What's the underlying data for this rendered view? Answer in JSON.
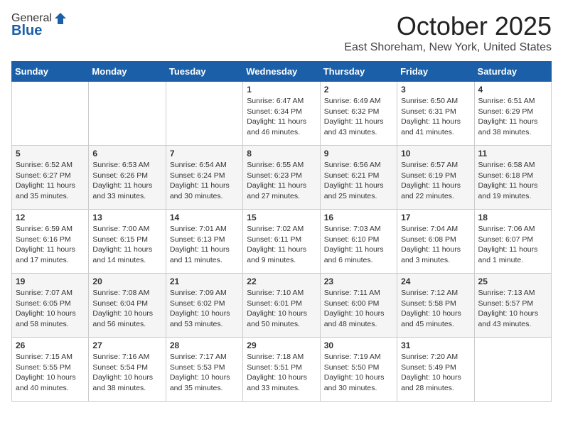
{
  "logo": {
    "general": "General",
    "blue": "Blue"
  },
  "header": {
    "month": "October 2025",
    "location": "East Shoreham, New York, United States"
  },
  "days_of_week": [
    "Sunday",
    "Monday",
    "Tuesday",
    "Wednesday",
    "Thursday",
    "Friday",
    "Saturday"
  ],
  "weeks": [
    [
      {
        "day": "",
        "sunrise": "",
        "sunset": "",
        "daylight": ""
      },
      {
        "day": "",
        "sunrise": "",
        "sunset": "",
        "daylight": ""
      },
      {
        "day": "",
        "sunrise": "",
        "sunset": "",
        "daylight": ""
      },
      {
        "day": "1",
        "sunrise": "Sunrise: 6:47 AM",
        "sunset": "Sunset: 6:34 PM",
        "daylight": "Daylight: 11 hours and 46 minutes."
      },
      {
        "day": "2",
        "sunrise": "Sunrise: 6:49 AM",
        "sunset": "Sunset: 6:32 PM",
        "daylight": "Daylight: 11 hours and 43 minutes."
      },
      {
        "day": "3",
        "sunrise": "Sunrise: 6:50 AM",
        "sunset": "Sunset: 6:31 PM",
        "daylight": "Daylight: 11 hours and 41 minutes."
      },
      {
        "day": "4",
        "sunrise": "Sunrise: 6:51 AM",
        "sunset": "Sunset: 6:29 PM",
        "daylight": "Daylight: 11 hours and 38 minutes."
      }
    ],
    [
      {
        "day": "5",
        "sunrise": "Sunrise: 6:52 AM",
        "sunset": "Sunset: 6:27 PM",
        "daylight": "Daylight: 11 hours and 35 minutes."
      },
      {
        "day": "6",
        "sunrise": "Sunrise: 6:53 AM",
        "sunset": "Sunset: 6:26 PM",
        "daylight": "Daylight: 11 hours and 33 minutes."
      },
      {
        "day": "7",
        "sunrise": "Sunrise: 6:54 AM",
        "sunset": "Sunset: 6:24 PM",
        "daylight": "Daylight: 11 hours and 30 minutes."
      },
      {
        "day": "8",
        "sunrise": "Sunrise: 6:55 AM",
        "sunset": "Sunset: 6:23 PM",
        "daylight": "Daylight: 11 hours and 27 minutes."
      },
      {
        "day": "9",
        "sunrise": "Sunrise: 6:56 AM",
        "sunset": "Sunset: 6:21 PM",
        "daylight": "Daylight: 11 hours and 25 minutes."
      },
      {
        "day": "10",
        "sunrise": "Sunrise: 6:57 AM",
        "sunset": "Sunset: 6:19 PM",
        "daylight": "Daylight: 11 hours and 22 minutes."
      },
      {
        "day": "11",
        "sunrise": "Sunrise: 6:58 AM",
        "sunset": "Sunset: 6:18 PM",
        "daylight": "Daylight: 11 hours and 19 minutes."
      }
    ],
    [
      {
        "day": "12",
        "sunrise": "Sunrise: 6:59 AM",
        "sunset": "Sunset: 6:16 PM",
        "daylight": "Daylight: 11 hours and 17 minutes."
      },
      {
        "day": "13",
        "sunrise": "Sunrise: 7:00 AM",
        "sunset": "Sunset: 6:15 PM",
        "daylight": "Daylight: 11 hours and 14 minutes."
      },
      {
        "day": "14",
        "sunrise": "Sunrise: 7:01 AM",
        "sunset": "Sunset: 6:13 PM",
        "daylight": "Daylight: 11 hours and 11 minutes."
      },
      {
        "day": "15",
        "sunrise": "Sunrise: 7:02 AM",
        "sunset": "Sunset: 6:11 PM",
        "daylight": "Daylight: 11 hours and 9 minutes."
      },
      {
        "day": "16",
        "sunrise": "Sunrise: 7:03 AM",
        "sunset": "Sunset: 6:10 PM",
        "daylight": "Daylight: 11 hours and 6 minutes."
      },
      {
        "day": "17",
        "sunrise": "Sunrise: 7:04 AM",
        "sunset": "Sunset: 6:08 PM",
        "daylight": "Daylight: 11 hours and 3 minutes."
      },
      {
        "day": "18",
        "sunrise": "Sunrise: 7:06 AM",
        "sunset": "Sunset: 6:07 PM",
        "daylight": "Daylight: 11 hours and 1 minute."
      }
    ],
    [
      {
        "day": "19",
        "sunrise": "Sunrise: 7:07 AM",
        "sunset": "Sunset: 6:05 PM",
        "daylight": "Daylight: 10 hours and 58 minutes."
      },
      {
        "day": "20",
        "sunrise": "Sunrise: 7:08 AM",
        "sunset": "Sunset: 6:04 PM",
        "daylight": "Daylight: 10 hours and 56 minutes."
      },
      {
        "day": "21",
        "sunrise": "Sunrise: 7:09 AM",
        "sunset": "Sunset: 6:02 PM",
        "daylight": "Daylight: 10 hours and 53 minutes."
      },
      {
        "day": "22",
        "sunrise": "Sunrise: 7:10 AM",
        "sunset": "Sunset: 6:01 PM",
        "daylight": "Daylight: 10 hours and 50 minutes."
      },
      {
        "day": "23",
        "sunrise": "Sunrise: 7:11 AM",
        "sunset": "Sunset: 6:00 PM",
        "daylight": "Daylight: 10 hours and 48 minutes."
      },
      {
        "day": "24",
        "sunrise": "Sunrise: 7:12 AM",
        "sunset": "Sunset: 5:58 PM",
        "daylight": "Daylight: 10 hours and 45 minutes."
      },
      {
        "day": "25",
        "sunrise": "Sunrise: 7:13 AM",
        "sunset": "Sunset: 5:57 PM",
        "daylight": "Daylight: 10 hours and 43 minutes."
      }
    ],
    [
      {
        "day": "26",
        "sunrise": "Sunrise: 7:15 AM",
        "sunset": "Sunset: 5:55 PM",
        "daylight": "Daylight: 10 hours and 40 minutes."
      },
      {
        "day": "27",
        "sunrise": "Sunrise: 7:16 AM",
        "sunset": "Sunset: 5:54 PM",
        "daylight": "Daylight: 10 hours and 38 minutes."
      },
      {
        "day": "28",
        "sunrise": "Sunrise: 7:17 AM",
        "sunset": "Sunset: 5:53 PM",
        "daylight": "Daylight: 10 hours and 35 minutes."
      },
      {
        "day": "29",
        "sunrise": "Sunrise: 7:18 AM",
        "sunset": "Sunset: 5:51 PM",
        "daylight": "Daylight: 10 hours and 33 minutes."
      },
      {
        "day": "30",
        "sunrise": "Sunrise: 7:19 AM",
        "sunset": "Sunset: 5:50 PM",
        "daylight": "Daylight: 10 hours and 30 minutes."
      },
      {
        "day": "31",
        "sunrise": "Sunrise: 7:20 AM",
        "sunset": "Sunset: 5:49 PM",
        "daylight": "Daylight: 10 hours and 28 minutes."
      },
      {
        "day": "",
        "sunrise": "",
        "sunset": "",
        "daylight": ""
      }
    ]
  ]
}
